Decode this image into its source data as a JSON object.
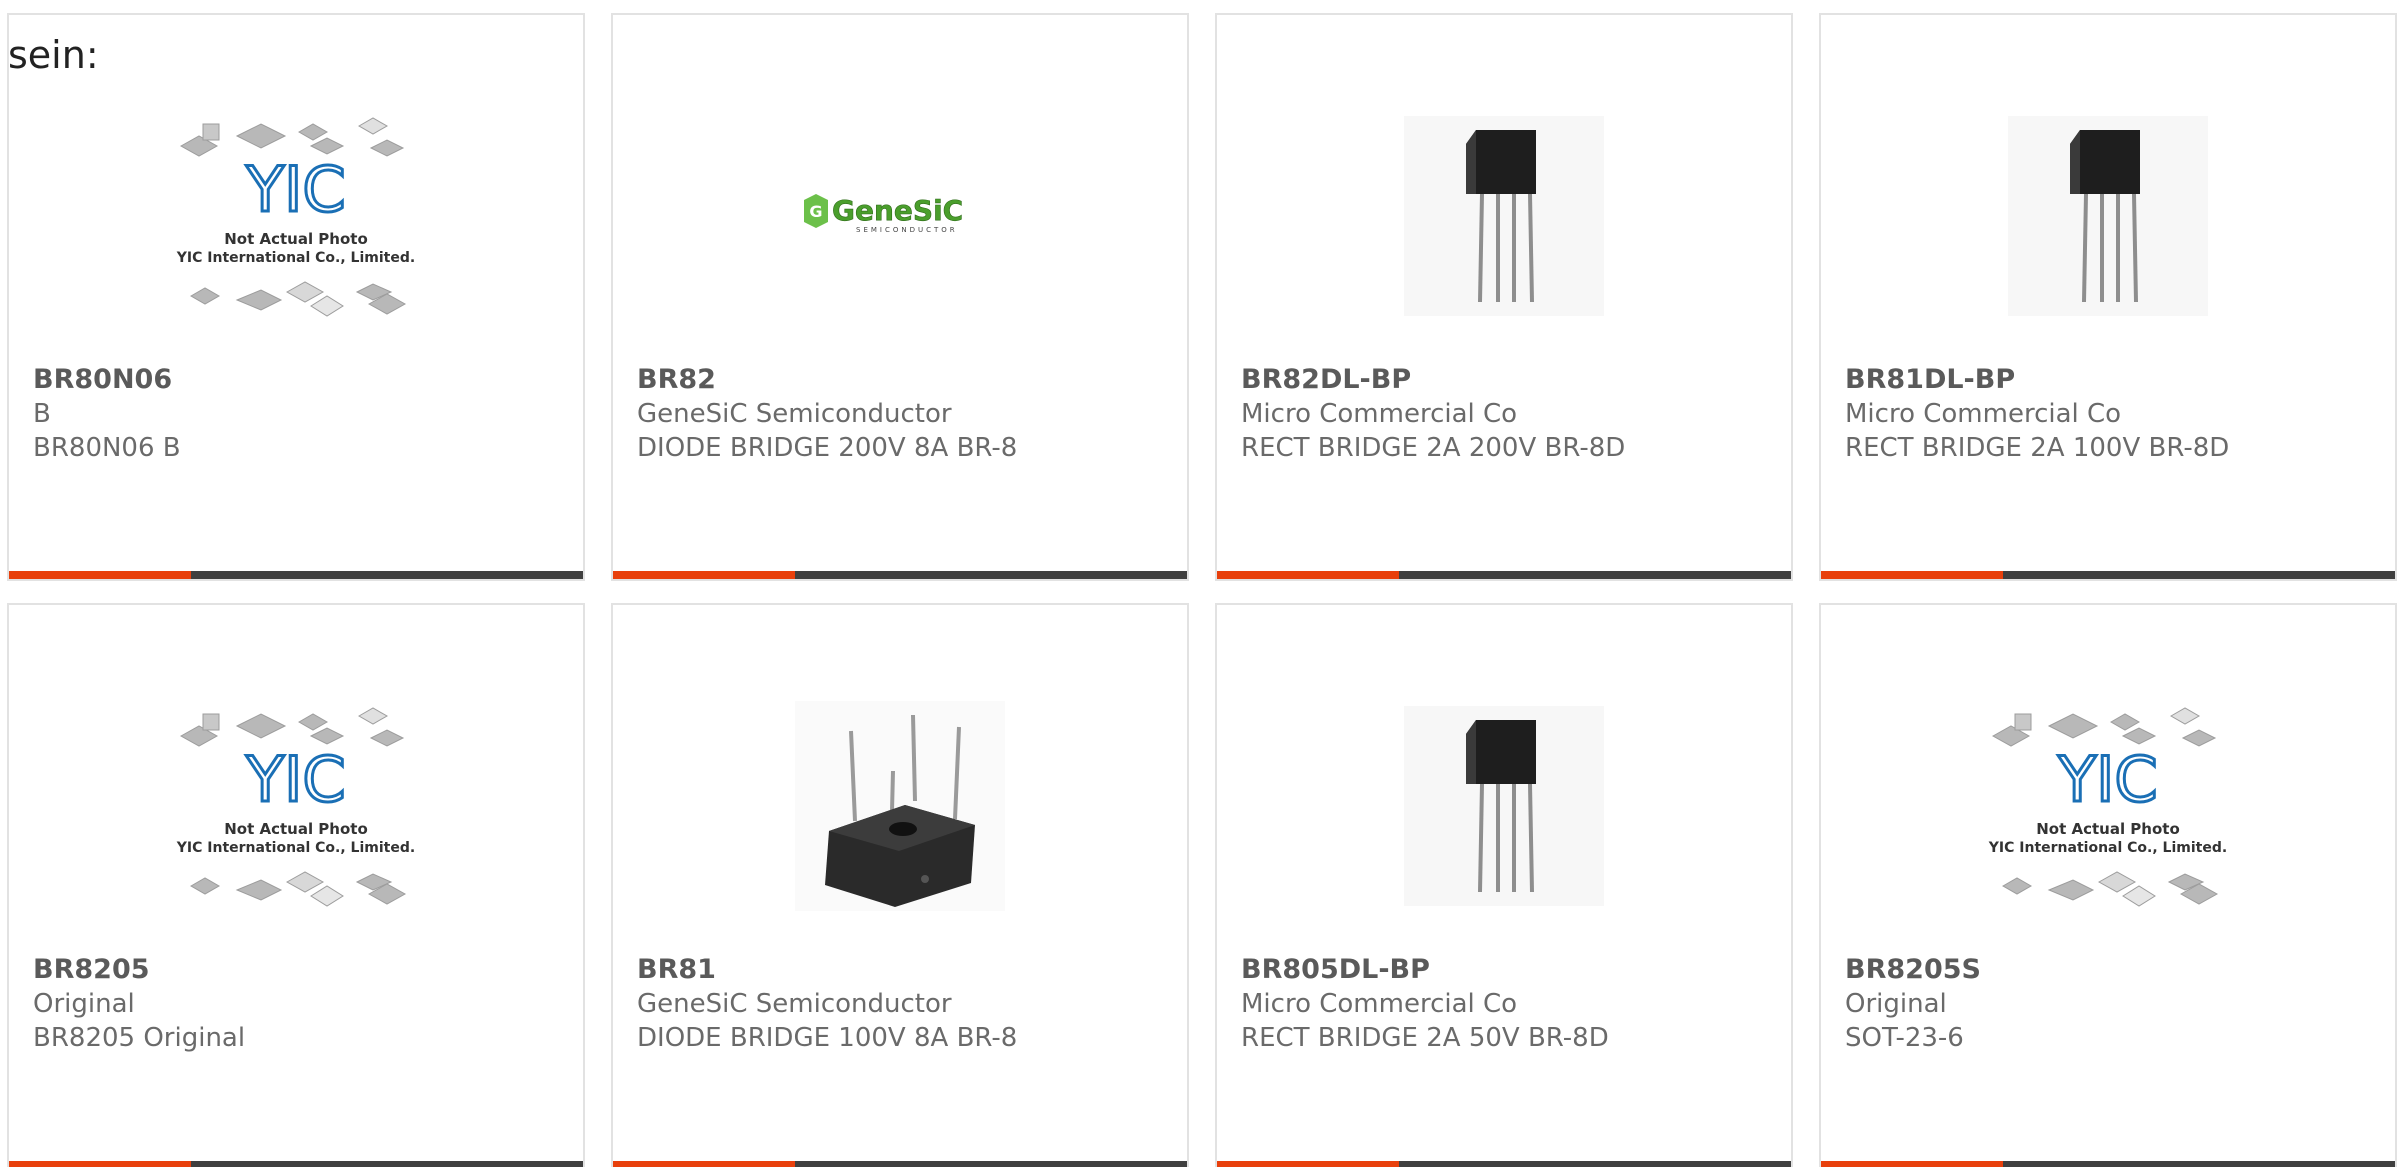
{
  "intro": {
    "text": "sein:"
  },
  "colors": {
    "accent": "#e8400c",
    "bar": "#3f3f3f",
    "title": "#5a5a5a",
    "text": "#6a6a6a"
  },
  "placeholder_image": {
    "line1": "Not Actual Photo",
    "line2": "YIC International Co., Limited.",
    "logo": "YIC"
  },
  "genesic_logo": {
    "text": "GeneSiC",
    "sub": "SEMICONDUCTOR"
  },
  "products": [
    {
      "title": "BR80N06",
      "manufacturer": "B",
      "description": "BR80N06 B",
      "image": "yic-placeholder"
    },
    {
      "title": "BR82",
      "manufacturer": "GeneSiC Semiconductor",
      "description": "DIODE BRIDGE 200V 8A BR-8",
      "image": "genesic-logo"
    },
    {
      "title": "BR82DL-BP",
      "manufacturer": "Micro Commercial Co",
      "description": "RECT BRIDGE 2A 200V BR-8D",
      "image": "sip-bridge"
    },
    {
      "title": "BR81DL-BP",
      "manufacturer": "Micro Commercial Co",
      "description": "RECT BRIDGE 2A 100V BR-8D",
      "image": "sip-bridge"
    },
    {
      "title": "BR8205",
      "manufacturer": "Original",
      "description": "BR8205 Original",
      "image": "yic-placeholder"
    },
    {
      "title": "BR81",
      "manufacturer": "GeneSiC Semiconductor",
      "description": "DIODE BRIDGE 100V 8A BR-8",
      "image": "square-bridge"
    },
    {
      "title": "BR805DL-BP",
      "manufacturer": "Micro Commercial Co",
      "description": "RECT BRIDGE 2A 50V BR-8D",
      "image": "sip-bridge"
    },
    {
      "title": "BR8205S",
      "manufacturer": "Original",
      "description": "SOT-23-6",
      "image": "yic-placeholder"
    }
  ]
}
